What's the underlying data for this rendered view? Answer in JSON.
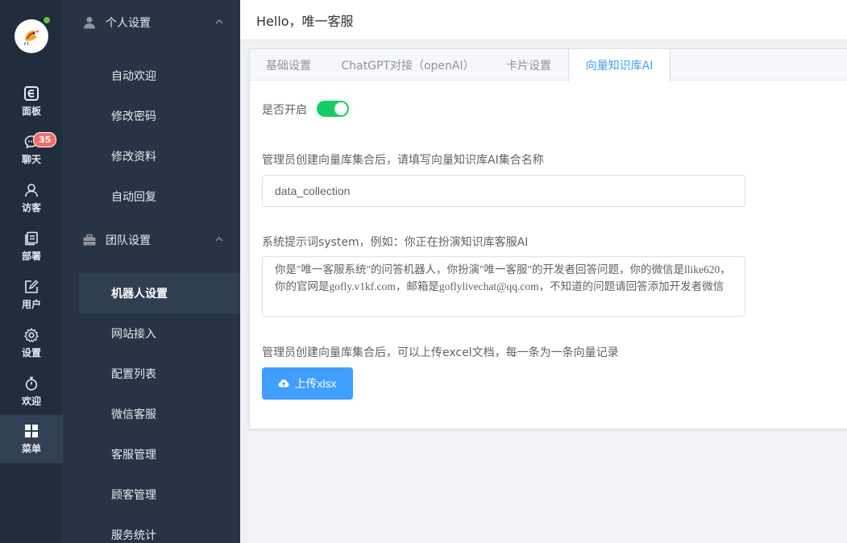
{
  "header": {
    "greeting": "Hello，唯一客服"
  },
  "rail": {
    "items": [
      {
        "label": "面板",
        "icon": "dashboard-icon"
      },
      {
        "label": "聊天",
        "icon": "chat-icon",
        "badge": "35"
      },
      {
        "label": "访客",
        "icon": "visitor-icon"
      },
      {
        "label": "部署",
        "icon": "deploy-icon"
      },
      {
        "label": "用户",
        "icon": "user-edit-icon"
      },
      {
        "label": "设置",
        "icon": "gear-icon"
      },
      {
        "label": "欢迎",
        "icon": "stopwatch-icon"
      },
      {
        "label": "菜单",
        "icon": "grid-menu-icon",
        "active": true
      }
    ]
  },
  "submenu": {
    "groups": [
      {
        "label": "个人设置",
        "icon": "user-icon",
        "items": [
          "自动欢迎",
          "修改密码",
          "修改资料",
          "自动回复"
        ]
      },
      {
        "label": "团队设置",
        "icon": "briefcase-icon",
        "items": [
          "机器人设置",
          "网站接入",
          "配置列表",
          "微信客服",
          "客服管理",
          "顾客管理",
          "服务统计"
        ]
      }
    ],
    "active_item": "机器人设置"
  },
  "tabs": [
    {
      "label": "基础设置"
    },
    {
      "label": "ChatGPT对接（openAI）"
    },
    {
      "label": "卡片设置"
    },
    {
      "label": "向量知识库AI",
      "active": true
    }
  ],
  "form": {
    "enable_label": "是否开启",
    "enable_value": true,
    "collection_label": "管理员创建向量库集合后，请填写向量知识库AI集合名称",
    "collection_value": "data_collection",
    "prompt_label": "系统提示词system，例如：你正在扮演知识库客服AI",
    "prompt_value": "你是\"唯一客服系统\"的问答机器人，你扮演\"唯一客服\"的开发者回答问题，你的微信是llike620，你的官网是gofly.v1kf.com，邮箱是goflylivechat@qq.com，不知道的问题请回答添加开发者微信",
    "upload_label": "管理员创建向量库集合后，可以上传excel文档，每一条为一条向量记录",
    "upload_button": "上传xlsx"
  },
  "colors": {
    "rail_bg": "#1f2d3d",
    "submenu_bg": "#263445",
    "accent": "#409eff",
    "switch_on": "#13ce66",
    "badge": "#f56c6c"
  }
}
